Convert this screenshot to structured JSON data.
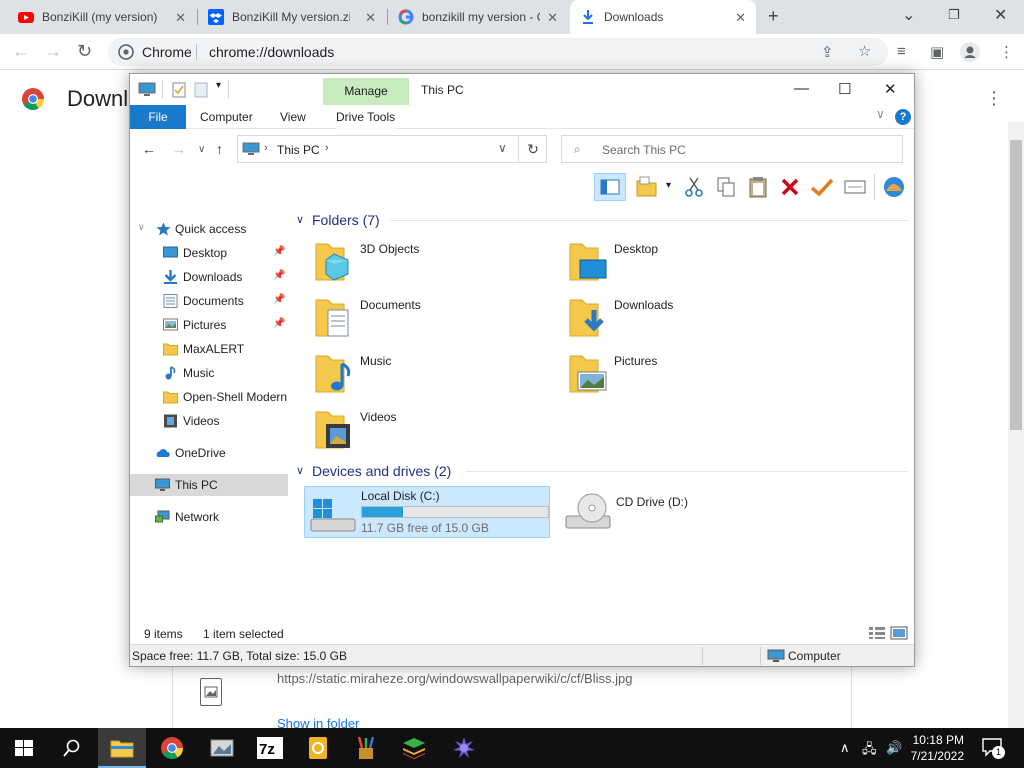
{
  "chrome": {
    "tabs": [
      {
        "title": "BonziKill (my version) (",
        "icon": "youtube-icon"
      },
      {
        "title": "BonziKill My version.zip",
        "icon": "dropbox-icon"
      },
      {
        "title": "bonzikill my version - C",
        "icon": "google-icon"
      },
      {
        "title": "Downloads",
        "icon": "download-icon"
      }
    ],
    "new_tab": "+",
    "window_controls": {
      "minimize": "⌄",
      "restore": "❐",
      "close": "✕"
    },
    "omnibox": {
      "site": "Chrome",
      "url": "chrome://downloads"
    },
    "page": {
      "title": "Downl",
      "item_url": "https://static.miraheze.org/windowswallpaperwiki/c/cf/Bliss.jpg",
      "show_in_folder": "Show in folder"
    }
  },
  "explorer": {
    "title": "This PC",
    "manage_tab": "Manage",
    "ribbon_tabs": [
      "File",
      "Computer",
      "View",
      "Drive Tools"
    ],
    "address": "This PC",
    "search_placeholder": "Search This PC",
    "nav": {
      "quick_access": "Quick access",
      "items": [
        {
          "label": "Desktop",
          "pinned": true
        },
        {
          "label": "Downloads",
          "pinned": true
        },
        {
          "label": "Documents",
          "pinned": true
        },
        {
          "label": "Pictures",
          "pinned": true
        },
        {
          "label": "MaxALERT",
          "pinned": false
        },
        {
          "label": "Music",
          "pinned": false
        },
        {
          "label": "Open-Shell Modern",
          "pinned": false
        },
        {
          "label": "Videos",
          "pinned": false
        }
      ],
      "onedrive": "OneDrive",
      "this_pc": "This PC",
      "network": "Network"
    },
    "folders_header": "Folders (7)",
    "folders": [
      "3D Objects",
      "Desktop",
      "Documents",
      "Downloads",
      "Music",
      "Pictures",
      "Videos"
    ],
    "devices_header": "Devices and drives (2)",
    "drives": [
      {
        "name": "Local Disk (C:)",
        "free": "11.7 GB free of 15.0 GB",
        "used_fraction": 0.22
      },
      {
        "name": "CD Drive (D:)"
      }
    ],
    "status": {
      "items": "9 items",
      "selected": "1 item selected"
    },
    "footer": {
      "space": "Space free: 11.7 GB, Total size: 15.0 GB",
      "location": "Computer"
    }
  },
  "taskbar": {
    "time": "10:18 PM",
    "date": "7/21/2022",
    "notification_count": "1"
  },
  "colors": {
    "accent": "#1979ca",
    "manage_tab": "#c7eabf",
    "drive_fill": "#26a0da",
    "selection": "#cce8ff"
  }
}
